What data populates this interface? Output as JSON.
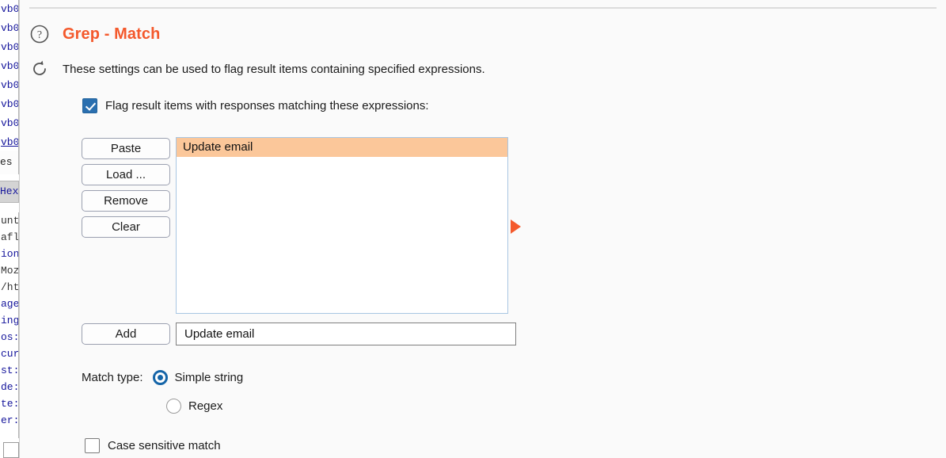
{
  "background_window": {
    "hex_rows": [
      "vb0",
      "vb0",
      "vb0",
      "vb0",
      "vb0",
      "vb0",
      "vb0",
      "vb0"
    ],
    "tab_partial_1": "es",
    "tab_partial_2": "Hex",
    "header_rows": [
      "unt",
      "afl",
      "ion",
      "Moz",
      "/ht",
      "age",
      "ing",
      "os:",
      "cur",
      "st:",
      "de:",
      "te:",
      "er:"
    ]
  },
  "panel": {
    "title": "Grep - Match",
    "title_color": "#f4592c",
    "help_icon": "question-mark-circle-icon",
    "refresh_icon": "refresh-icon",
    "subtitle": "These settings can be used to flag result items containing specified expressions.",
    "flag_checkbox": {
      "label": "Flag result items with responses matching these expressions:",
      "checked": true
    },
    "buttons": [
      {
        "label": "Paste",
        "name": "paste-button"
      },
      {
        "label": "Load ...",
        "name": "load-button"
      },
      {
        "label": "Remove",
        "name": "remove-button"
      },
      {
        "label": "Clear",
        "name": "clear-button"
      }
    ],
    "expression_list": {
      "items": [
        {
          "text": "Update email",
          "selected": true
        }
      ],
      "selection_color": "#fbc79a",
      "border_color": "#a8c6e2"
    },
    "marker_icon": "play-triangle-icon",
    "marker_color": "#f4592c",
    "add_row": {
      "button_label": "Add",
      "input_value": "Update email",
      "input_placeholder": ""
    },
    "match_type": {
      "label": "Match type:",
      "options": [
        {
          "label": "Simple string",
          "selected": true
        },
        {
          "label": "Regex",
          "selected": false
        }
      ]
    },
    "case_sensitive": {
      "label": "Case sensitive match",
      "checked": false
    }
  }
}
